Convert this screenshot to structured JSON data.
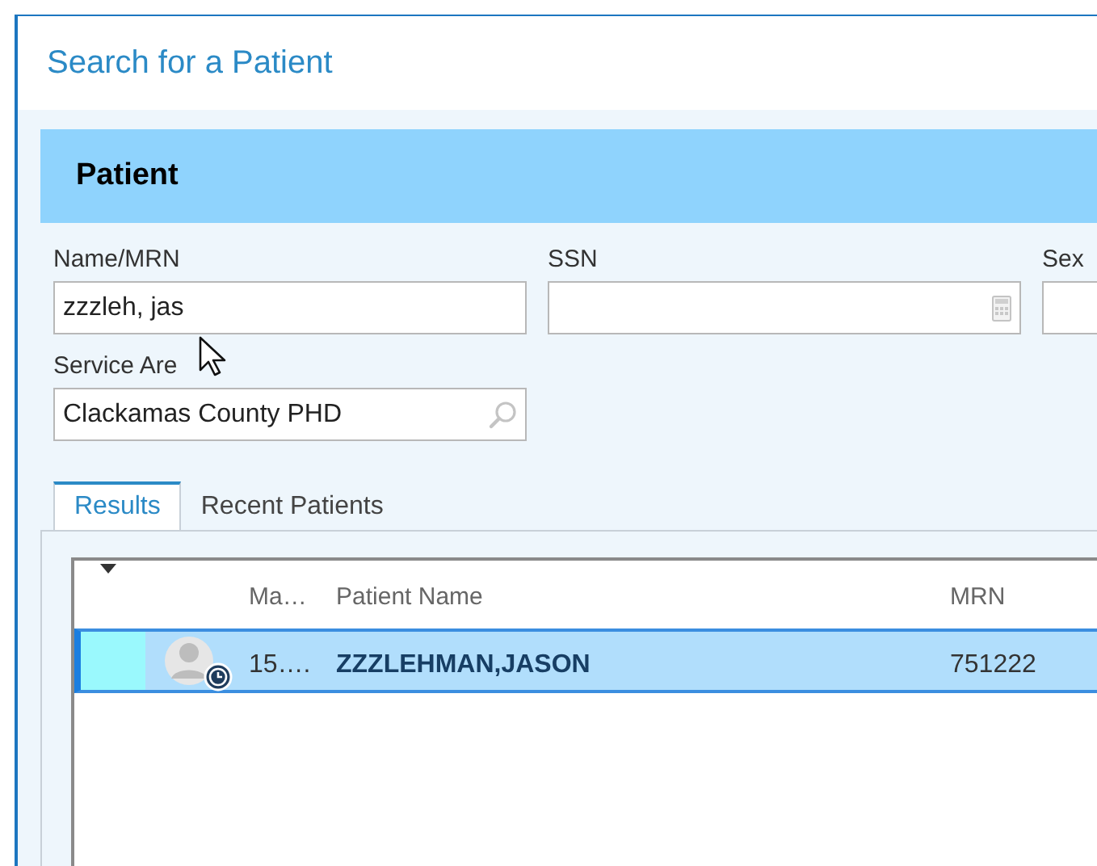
{
  "window": {
    "title": "Search for a Patient"
  },
  "section": {
    "title": "Patient"
  },
  "fields": [
    {
      "label": "Name/MRN",
      "value": "zzzleh, jas",
      "kind": "text"
    },
    {
      "label": "SSN",
      "kind": "ssn"
    },
    {
      "label": "Sex",
      "kind": "select"
    },
    {
      "label": "Service Are",
      "value": "Clackamas County PHD",
      "kind": "lookup"
    }
  ],
  "tabs": [
    {
      "label": "Results",
      "selected": true
    },
    {
      "label": "Recent Patients",
      "selected": false
    }
  ],
  "table": {
    "columns": [
      "Ma…",
      "Patient Name",
      "MRN"
    ],
    "rows": [
      {
        "selected": true,
        "cells": [
          "15….",
          "ZZZLEHMAN,JASON",
          "751222"
        ]
      }
    ]
  }
}
